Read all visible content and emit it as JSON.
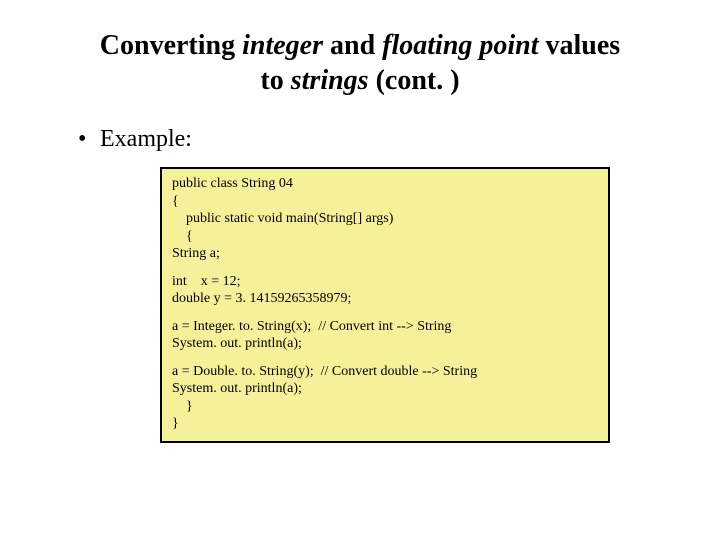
{
  "title": {
    "t1": "Converting ",
    "t2": "integer",
    "t3": " and ",
    "t4": "floating point",
    "t5": " values",
    "t6": "to ",
    "t7": "strings",
    "t8": " (cont. )"
  },
  "bullet": {
    "dot": "•",
    "label": "Example:"
  },
  "code": {
    "b1": {
      "l1": "public class String 04",
      "l2": "{",
      "l3": "public static void main(String[] args)",
      "l4": "{",
      "l5": "String a;"
    },
    "b2": {
      "l1": "int    x = 12;",
      "l2": "double y = 3. 14159265358979;"
    },
    "b3": {
      "l1": "a = Integer. to. String(x);  // Convert int --> String",
      "l2": "System. out. println(a);"
    },
    "b4": {
      "l1": "a = Double. to. String(y);  // Convert double --> String",
      "l2": "System. out. println(a);",
      "l3": "}",
      "l4": "}"
    }
  }
}
